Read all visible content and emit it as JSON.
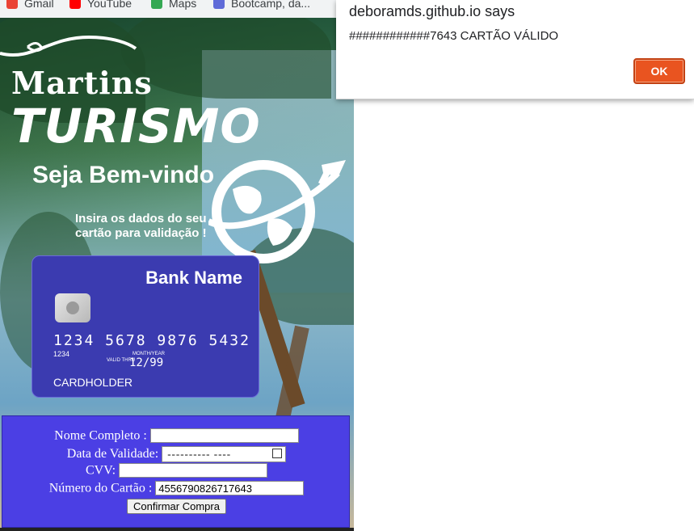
{
  "bookmarks": [
    {
      "label": "Gmail",
      "icon": "gmail-icon",
      "color": "#ea4335"
    },
    {
      "label": "YouTube",
      "icon": "youtube-icon",
      "color": "#ff0000"
    },
    {
      "label": "Maps",
      "icon": "maps-icon",
      "color": "#34a853"
    },
    {
      "label": "Bootcamp, da...",
      "icon": "bootcamp-icon",
      "color": "#5f6bd8"
    }
  ],
  "page": {
    "brand_top": "Martins",
    "brand_bottom": "TURISMO",
    "welcome": "Seja Bem-vindo",
    "instructions": "Insira os dados do seu cartão para validação !",
    "globe_icon": "globe-plane-icon"
  },
  "card": {
    "bank_name": "Bank Name",
    "number": "1234 5678 9876 5432",
    "number_short": "1234",
    "valid_thru": "VALID THRU",
    "month_year": "MONTH/YEAR",
    "expiry": "12/99",
    "holder": "CARDHOLDER",
    "color": "#3b3bb0"
  },
  "form": {
    "name_label": "Nome Completo :",
    "name_value": "",
    "validity_label": "Data de Validade:",
    "validity_value": "---------- ----",
    "cvv_label": "CVV:",
    "cvv_value": "",
    "card_number_label": "Número do Cartão :",
    "card_number_value": "4556790826717643",
    "submit_label": "Confirmar Compra",
    "background": "#4b3fe4"
  },
  "dialog": {
    "title": "deboramds.github.io says",
    "message": "############7643 CARTÃO VÁLIDO",
    "ok_label": "OK",
    "ok_color": "#e95420"
  }
}
